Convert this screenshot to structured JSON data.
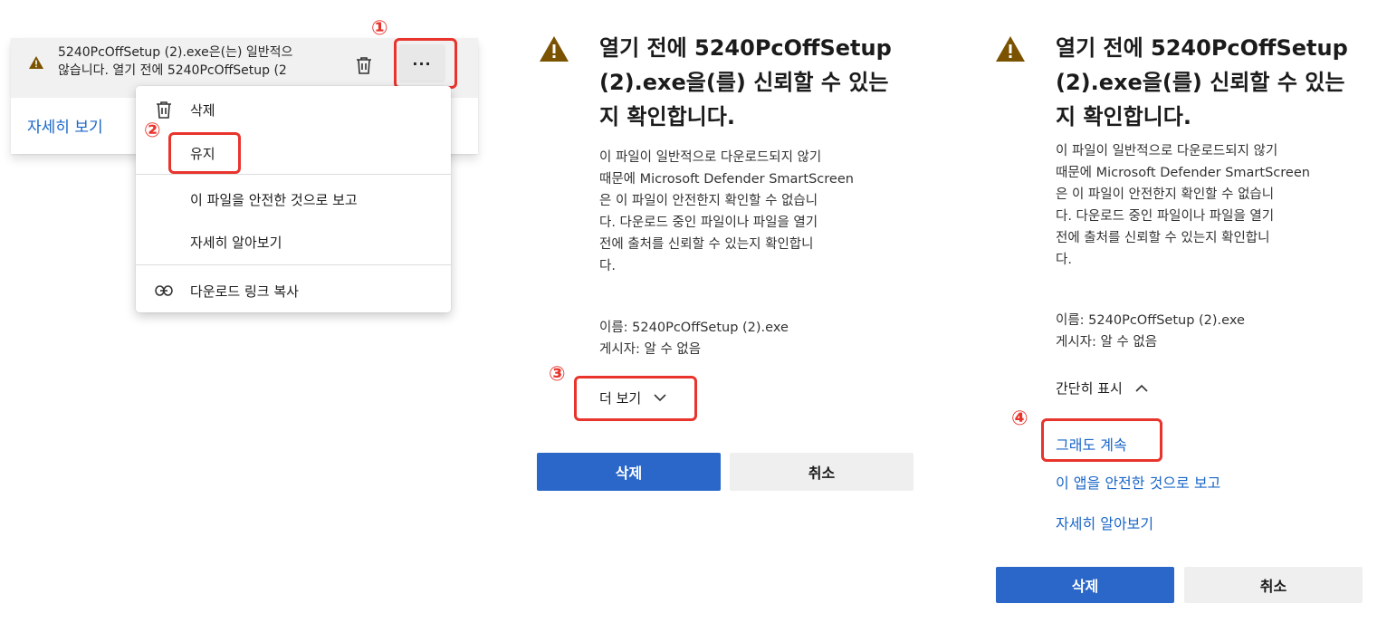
{
  "step_markers": [
    "①",
    "②",
    "③",
    "④"
  ],
  "colors": {
    "accent": "#2a67c8",
    "link": "#1a66c7",
    "warning": "#8a5a00",
    "highlight": "#e8342c"
  },
  "download_item": {
    "line1": "5240PcOffSetup (2).exe은(는) 일반적으",
    "line2": "않습니다. 열기 전에 5240PcOffSetup (2",
    "details_link": "자세히 보기",
    "more_label": "···",
    "icons": {
      "warning": "warning-triangle-icon",
      "delete": "trash-icon",
      "more": "more-icon"
    }
  },
  "context_menu": {
    "items": [
      {
        "label": "삭제",
        "icon": "trash-icon"
      },
      {
        "label": "유지",
        "icon": ""
      },
      {
        "label": "이 파일을 안전한 것으로 보고",
        "icon": ""
      },
      {
        "label": "자세히 알아보기",
        "icon": ""
      },
      {
        "label": "다운로드 링크 복사",
        "icon": "link-icon"
      }
    ]
  },
  "dialog_collapsed": {
    "title_lines": [
      "열기 전에 5240PcOffSetup",
      "(2).exe을(를) 신뢰할 수 있는",
      "지 확인합니다."
    ],
    "body_lines": [
      "이 파일이 일반적으로 다운로드되지 않기",
      "때문에 Microsoft Defender SmartScreen",
      "은 이 파일이 안전한지 확인할 수 없습니",
      "다. 다운로드 중인 파일이나 파일을 열기",
      "전에 출처를 신뢰할 수 있는지 확인합니",
      "다."
    ],
    "name_line": "이름: 5240PcOffSetup (2).exe",
    "publisher_line": "게시자: 알 수 없음",
    "toggle_label": "더 보기",
    "toggle_icon": "chevron-down-icon",
    "delete_button": "삭제",
    "cancel_button": "취소"
  },
  "dialog_expanded": {
    "title_lines": [
      "열기 전에 5240PcOffSetup",
      "(2).exe을(를) 신뢰할 수 있는",
      "지 확인합니다."
    ],
    "body_lines": [
      "이 파일이 일반적으로 다운로드되지 않기",
      "때문에 Microsoft Defender SmartScreen",
      "은 이 파일이 안전한지 확인할 수 없습니",
      "다. 다운로드 중인 파일이나 파일을 열기",
      "전에 출처를 신뢰할 수 있는지 확인합니",
      "다."
    ],
    "name_line": "이름: 5240PcOffSetup (2).exe",
    "publisher_line": "게시자: 알 수 없음",
    "toggle_label": "간단히 표시",
    "toggle_icon": "chevron-up-icon",
    "links": [
      "그래도 계속",
      "이 앱을 안전한 것으로 보고",
      "자세히 알아보기"
    ],
    "delete_button": "삭제",
    "cancel_button": "취소"
  }
}
